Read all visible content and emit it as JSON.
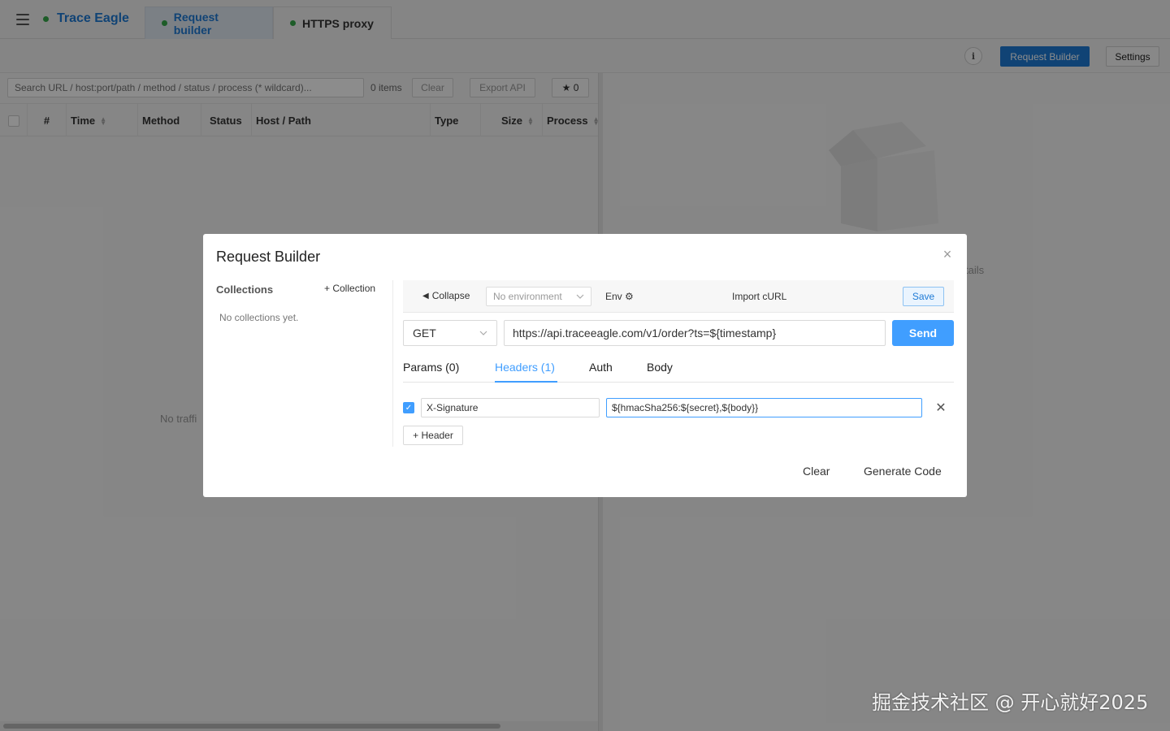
{
  "app": {
    "name": "Trace Eagle"
  },
  "tabs": [
    {
      "label": "Request builder",
      "active": true
    },
    {
      "label": "HTTPS proxy",
      "active": false
    }
  ],
  "topbar": {
    "info_label": "i",
    "request_builder_label": "Request Builder",
    "settings_label": "Settings"
  },
  "traffic": {
    "search_placeholder": "Search URL / host:port/path / method / status / process (* wildcard)...",
    "count": "0 items",
    "clear_label": "Clear",
    "export_label": "Export API",
    "star_label": "★ 0",
    "columns": [
      "#",
      "Time",
      "Method",
      "Status",
      "Host / Path",
      "Type",
      "Size",
      "Process"
    ],
    "empty_text": "No traffi",
    "details_hint": "tails"
  },
  "modal": {
    "title": "Request Builder",
    "close_icon": "×",
    "collections": {
      "heading": "Collections",
      "add_label": "+ Collection",
      "empty_text": "No collections yet."
    },
    "toolbar": {
      "collapse_label": "Collapse",
      "env_placeholder": "No environment",
      "env_label": "Env ⚙",
      "import_label": "Import cURL",
      "save_label": "Save"
    },
    "request": {
      "method": "GET",
      "url": "https://api.traceeagle.com/v1/order?ts=${timestamp}",
      "send_label": "Send"
    },
    "tabs": [
      {
        "label": "Params (0)",
        "active": false
      },
      {
        "label": "Headers (1)",
        "active": true
      },
      {
        "label": "Auth",
        "active": false
      },
      {
        "label": "Body",
        "active": false
      }
    ],
    "headers": [
      {
        "enabled": true,
        "key": "X-Signature",
        "value": "${hmacSha256:${secret},${body}}"
      }
    ],
    "add_header_label": "+ Header",
    "footer": {
      "clear_label": "Clear",
      "generate_label": "Generate Code"
    }
  },
  "colors": {
    "accent": "#409eff",
    "brand": "#1e7ad6",
    "status_dot": "#35a84a"
  },
  "watermark": "掘金技术社区 @ 开心就好2025"
}
